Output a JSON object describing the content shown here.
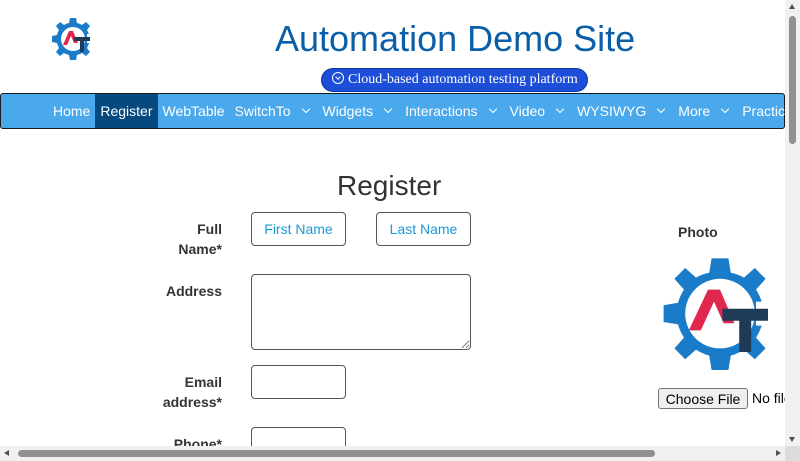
{
  "header": {
    "site_title": "Automation Demo Site",
    "tagline": "Cloud-based automation testing platform",
    "logo_letters": "AT"
  },
  "nav": {
    "items": [
      {
        "label": "Home",
        "has_dropdown": false,
        "active": false
      },
      {
        "label": "Register",
        "has_dropdown": false,
        "active": true
      },
      {
        "label": "WebTable",
        "has_dropdown": false,
        "active": false
      },
      {
        "label": "SwitchTo",
        "has_dropdown": true,
        "active": false
      },
      {
        "label": "Widgets",
        "has_dropdown": true,
        "active": false
      },
      {
        "label": "Interactions",
        "has_dropdown": true,
        "active": false
      },
      {
        "label": "Video",
        "has_dropdown": true,
        "active": false
      },
      {
        "label": "WYSIWYG",
        "has_dropdown": true,
        "active": false
      },
      {
        "label": "More",
        "has_dropdown": true,
        "active": false
      },
      {
        "label": "Practice Site",
        "has_dropdown": false,
        "active": false
      }
    ]
  },
  "form": {
    "title": "Register",
    "full_name_label_1": "Full",
    "full_name_label_2": "Name*",
    "first_name_placeholder": "First Name",
    "last_name_placeholder": "Last Name",
    "address_label": "Address",
    "address_value": "",
    "email_label_1": "Email",
    "email_label_2": "address*",
    "email_value": "",
    "phone_label": "Phone*",
    "phone_value": ""
  },
  "photo": {
    "label": "Photo",
    "choose_file_label": "Choose File",
    "file_status": "No file chosen"
  },
  "colors": {
    "title_blue": "#0b5ea8",
    "nav_bg": "#4aa8ec",
    "nav_active": "#06497e",
    "tagline_bg": "#1d4ed8",
    "logo_gear": "#1a7cc9",
    "logo_red": "#e0284f",
    "logo_dark": "#1f3b57"
  }
}
